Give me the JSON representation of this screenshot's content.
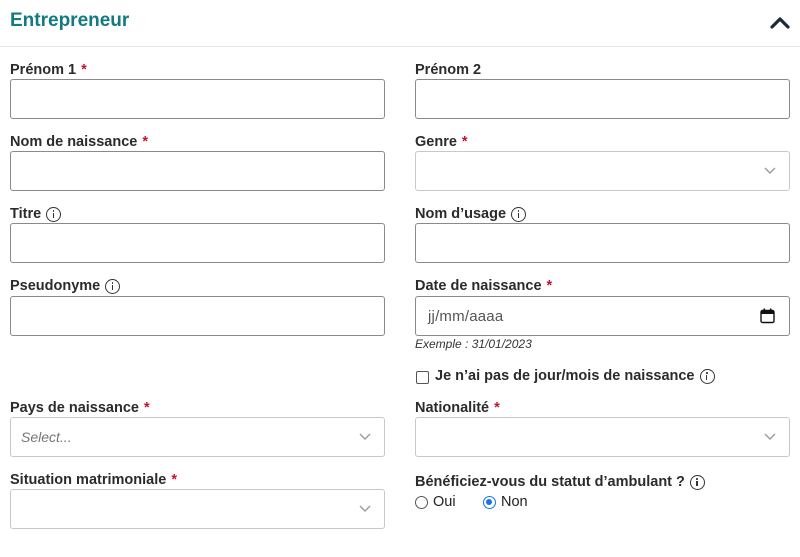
{
  "section": {
    "title": "Entrepreneur"
  },
  "fields": {
    "prenom1": {
      "label": "Prénom 1",
      "required": "*",
      "value": ""
    },
    "prenom2": {
      "label": "Prénom 2",
      "value": ""
    },
    "nom_naissance": {
      "label": "Nom de naissance",
      "required": "*",
      "value": ""
    },
    "genre": {
      "label": "Genre",
      "required": "*",
      "value": ""
    },
    "titre": {
      "label": "Titre",
      "value": ""
    },
    "nom_usage": {
      "label": "Nom d’usage",
      "value": ""
    },
    "pseudonyme": {
      "label": "Pseudonyme",
      "value": ""
    },
    "date_naissance": {
      "label": "Date de naissance",
      "required": "*",
      "placeholder": "jj/mm/aaaa",
      "hint": "Exemple : 31/01/2023"
    },
    "no_day_month": {
      "label": "Je n’ai pas de jour/mois de naissance",
      "checked": false
    },
    "pays_naissance": {
      "label": "Pays de naissance",
      "required": "*",
      "value": "Select..."
    },
    "nationalite": {
      "label": "Nationalité",
      "required": "*",
      "value": ""
    },
    "situation": {
      "label": "Situation matrimoniale",
      "required": "*",
      "value": ""
    },
    "ambulant": {
      "label": "Bénéficiez-vous du statut d’ambulant ?",
      "options": [
        "Oui",
        "Non"
      ],
      "selected": "Non"
    }
  },
  "icons": {
    "collapse": "chevron-up-icon",
    "info": "info-icon",
    "dropdown": "chevron-down-icon",
    "calendar": "calendar-icon"
  },
  "colors": {
    "title": "#127a80",
    "required": "#c8102e",
    "radio_selected": "#1a73e8"
  }
}
